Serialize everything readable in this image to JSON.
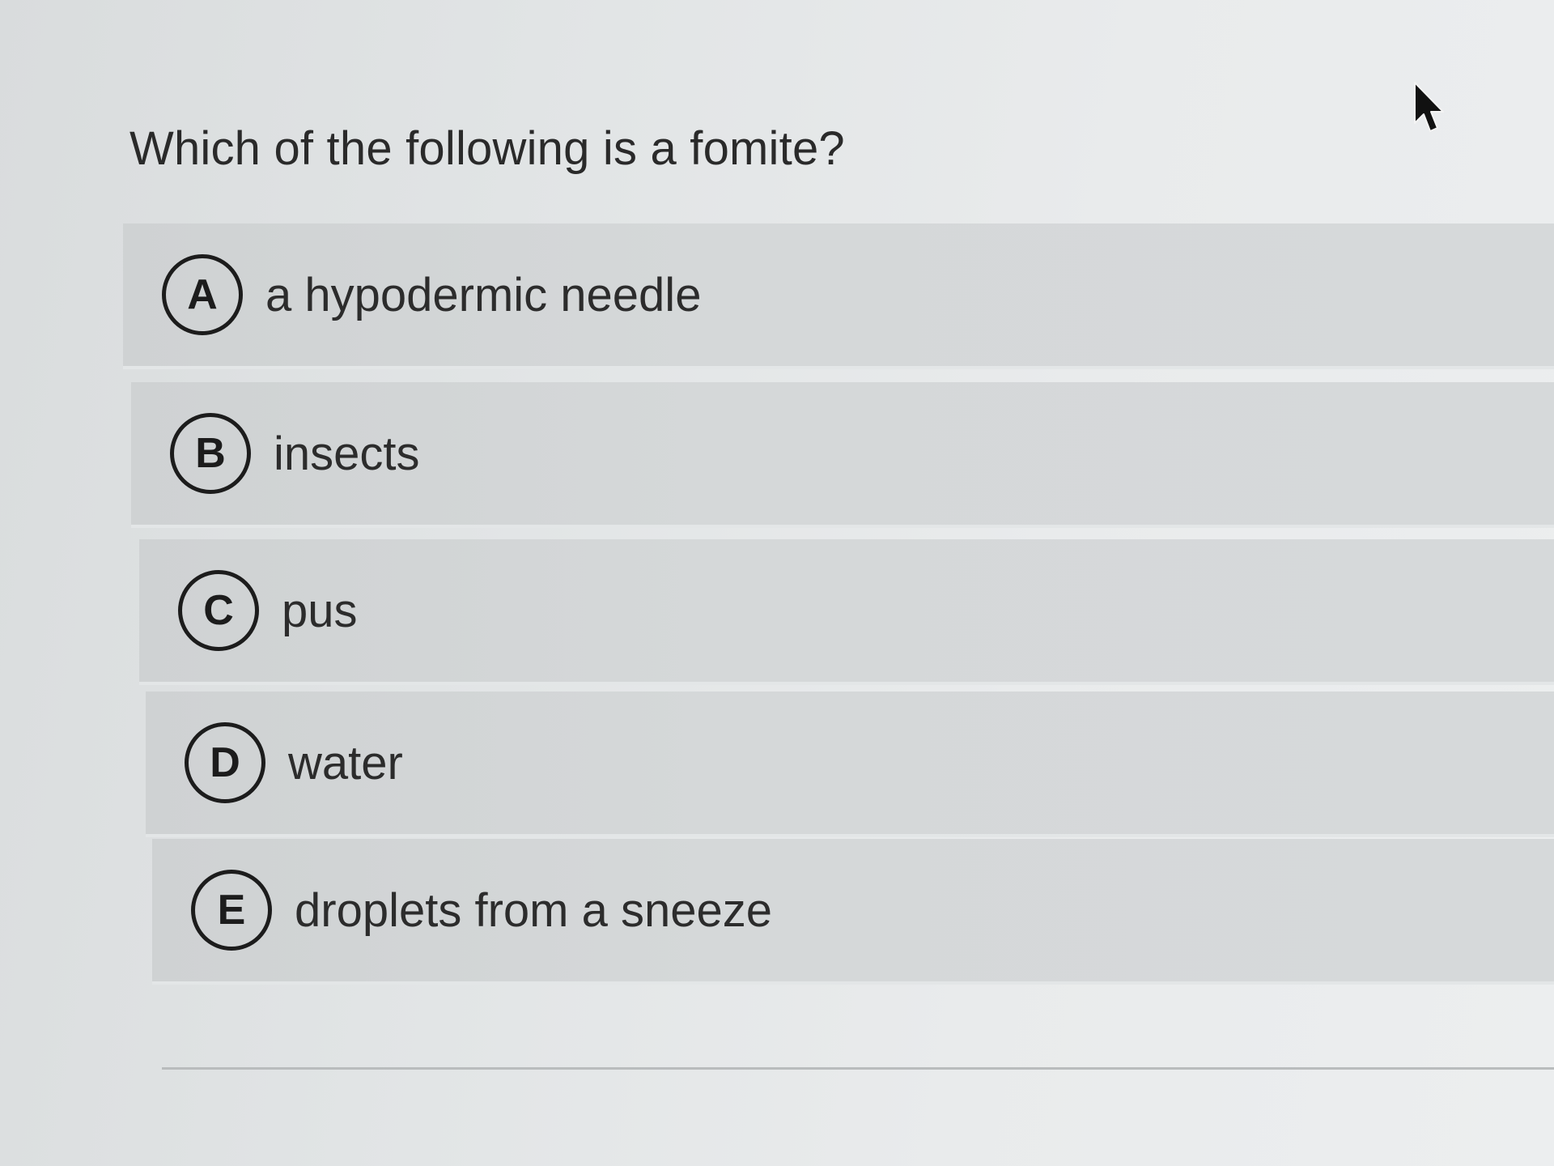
{
  "quiz": {
    "question": "Which of the following is a fomite?",
    "options": [
      {
        "letter": "A",
        "text": "a hypodermic needle"
      },
      {
        "letter": "B",
        "text": "insects"
      },
      {
        "letter": "C",
        "text": "pus"
      },
      {
        "letter": "D",
        "text": "water"
      },
      {
        "letter": "E",
        "text": "droplets from a sneeze"
      }
    ]
  },
  "icons": {
    "cursor": "mouse-pointer-icon"
  }
}
